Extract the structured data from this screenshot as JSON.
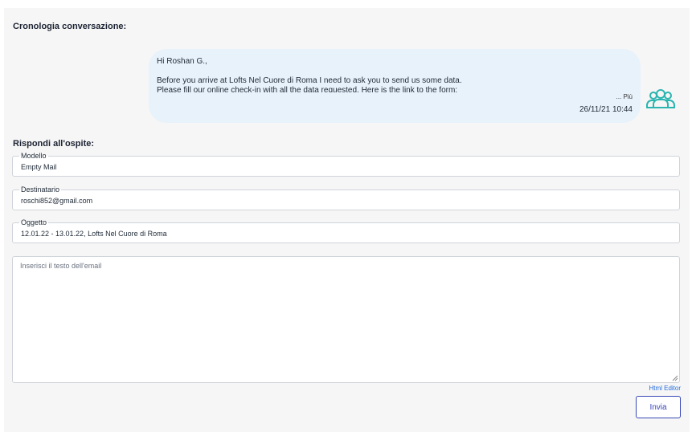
{
  "history": {
    "title": "Cronologia conversazione:",
    "message": {
      "greeting": "Hi Roshan G.,",
      "body_line1": "Before you arrive at Lofts Nel Cuore di Roma I need to ask you to send us some data.",
      "body_line2": "Please fill our online check-in with all the data requested. Here is the link to the form:",
      "more_label": "... Più",
      "timestamp": "26/11/21 10:44"
    },
    "avatar_color": "#2bb5b0"
  },
  "reply": {
    "title": "Rispondi all'ospite:",
    "template": {
      "label": "Modello",
      "value": "Empty Mail"
    },
    "recipient": {
      "label": "Destinatario",
      "value": "roschi852@gmail.com"
    },
    "subject": {
      "label": "Oggetto",
      "value": "12.01.22 - 13.01.22, Lofts Nel Cuore di Roma"
    },
    "body_placeholder": "Inserisci il testo dell'email",
    "html_editor_label": "Html Editor",
    "send_label": "Invia"
  }
}
